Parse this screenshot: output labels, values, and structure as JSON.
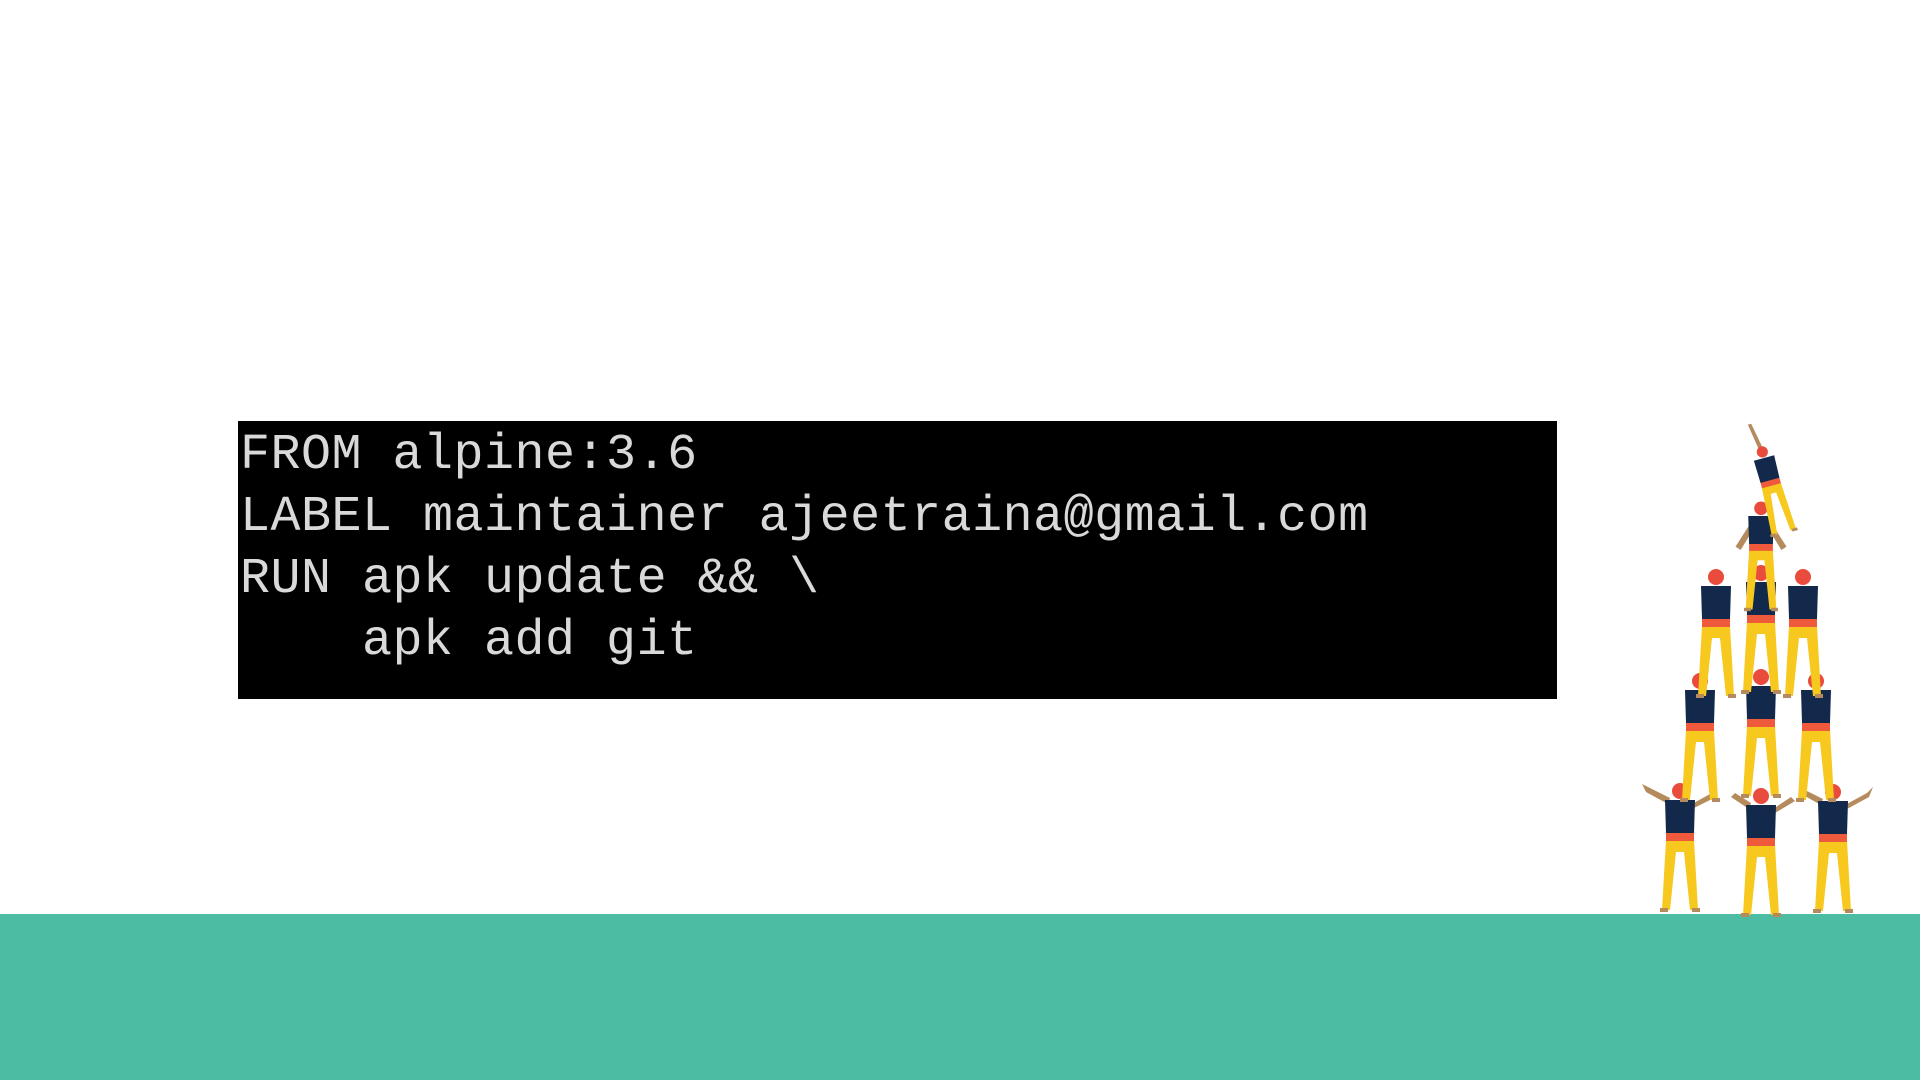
{
  "code": {
    "lines": [
      "FROM alpine:3.6",
      "LABEL maintainer ajeetraina@gmail.com",
      "RUN apk update && \\",
      "    apk add git"
    ]
  },
  "illustration": {
    "icon": "human-tower-icon",
    "colors": {
      "head": "#e94b3c",
      "shirt": "#13294b",
      "pants": "#f7c81e",
      "sash": "#ef5a3c",
      "skin": "#b58b5e"
    }
  },
  "colors": {
    "background": "#ffffff",
    "ground": "#4cbda3",
    "code_background": "#000000",
    "code_text": "#d9d9d9"
  }
}
